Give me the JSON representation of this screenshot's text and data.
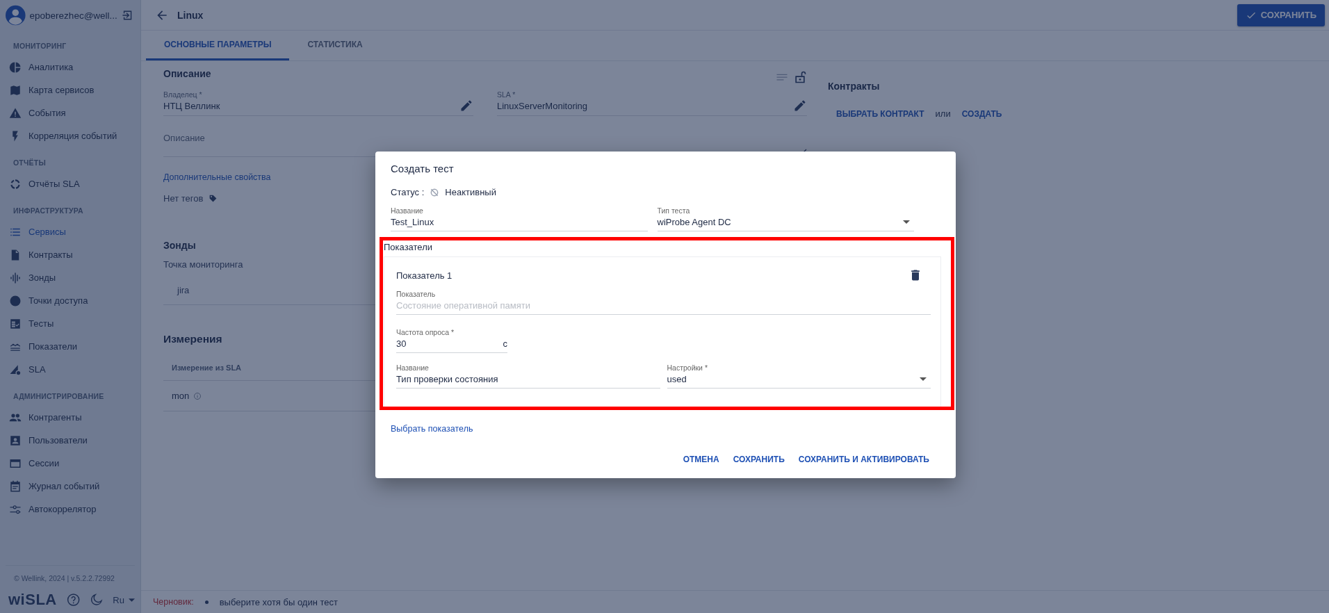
{
  "user": {
    "name": "epoberezhec@well..."
  },
  "sidebar": {
    "sections": [
      {
        "title": "МОНИТОРИНГ",
        "items": [
          {
            "label": "Аналитика",
            "selected": false
          },
          {
            "label": "Карта сервисов",
            "selected": false
          },
          {
            "label": "События",
            "selected": false
          },
          {
            "label": "Корреляция событий",
            "selected": false
          }
        ]
      },
      {
        "title": "ОТЧЁТЫ",
        "items": [
          {
            "label": "Отчёты SLA",
            "selected": false
          }
        ]
      },
      {
        "title": "ИНФРАСТРУКТУРА",
        "items": [
          {
            "label": "Сервисы",
            "selected": true
          },
          {
            "label": "Контракты",
            "selected": false
          },
          {
            "label": "Зонды",
            "selected": false
          },
          {
            "label": "Точки доступа",
            "selected": false
          },
          {
            "label": "Тесты",
            "selected": false
          },
          {
            "label": "Показатели",
            "selected": false
          },
          {
            "label": "SLA",
            "selected": false
          }
        ]
      },
      {
        "title": "АДМИНИСТРИРОВАНИЕ",
        "items": [
          {
            "label": "Контрагенты",
            "selected": false
          },
          {
            "label": "Пользователи",
            "selected": false
          },
          {
            "label": "Сессии",
            "selected": false
          },
          {
            "label": "Журнал событий",
            "selected": false
          },
          {
            "label": "Автокоррелятор",
            "selected": false
          }
        ]
      }
    ]
  },
  "sidebar_footer": {
    "copyright": "© Wellink, 2024 | v.5.2.2.72992",
    "logo": "wiSLA",
    "language": "Ru"
  },
  "header": {
    "title": "Linux",
    "save_button": "СОХРАНИТЬ"
  },
  "tabs": [
    {
      "label": "ОСНОВНЫЕ ПАРАМЕТРЫ",
      "selected": true
    },
    {
      "label": "СТАТИСТИКА",
      "selected": false
    }
  ],
  "description": {
    "title": "Описание",
    "owner": {
      "label": "Владелец *",
      "value": "НТЦ Веллинк"
    },
    "sla": {
      "label": "SLA *",
      "value": "LinuxServerMonitoring"
    },
    "placeholder": "Описание",
    "extra_link": "Дополнительные свойства",
    "tags": "Нет тегов"
  },
  "probes": {
    "title": "Зонды",
    "label": "Точка мониторинга",
    "value": "jira"
  },
  "measurements": {
    "title": "Измерения",
    "column": "Измерение из SLA",
    "rows": [
      "mon"
    ]
  },
  "contracts": {
    "title": "Контракты",
    "choose": "ВЫБРАТЬ КОНТРАКТ",
    "or": "или",
    "create": "СОЗДАТЬ"
  },
  "status_bar": {
    "label": "Черновик:",
    "message": "выберите хотя бы один тест"
  },
  "dialog": {
    "title": "Создать тест",
    "status_label": "Статус :",
    "status_value": "Неактивный",
    "name": {
      "label": "Название",
      "value": "Test_Linux"
    },
    "test_type": {
      "label": "Тип теста",
      "value": "wiProbe Agent DC"
    },
    "indicators": {
      "title": "Показатели",
      "items": [
        {
          "title": "Показатель 1",
          "indicator": {
            "label": "Показатель",
            "value": "Состояние оперативной памяти",
            "disabled": true
          },
          "frequency": {
            "label": "Частота опроса *",
            "value": "30",
            "unit": "с"
          },
          "name": {
            "label": "Название",
            "value": "Тип проверки состояния"
          },
          "settings": {
            "label": "Настройки *",
            "value": "used"
          }
        }
      ]
    },
    "choose_link": "Выбрать показатель",
    "buttons": [
      "ОТМЕНА",
      "СОХРАНИТЬ",
      "СОХРАНИТЬ И АКТИВИРОВАТЬ"
    ]
  }
}
